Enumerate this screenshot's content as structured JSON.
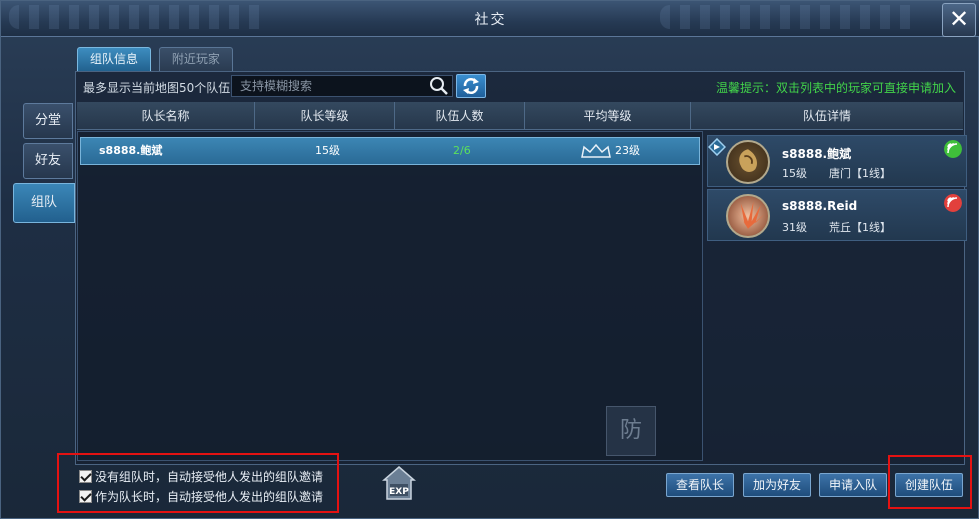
{
  "window": {
    "title": "社交",
    "close_label": "✕"
  },
  "side_tabs": [
    {
      "label": "分堂",
      "active": false
    },
    {
      "label": "好友",
      "active": false
    },
    {
      "label": "组队",
      "active": true
    }
  ],
  "top_tabs": [
    {
      "label": "组队信息",
      "active": true
    },
    {
      "label": "附近玩家",
      "active": false
    }
  ],
  "toolbar": {
    "info": "最多显示当前地图50个队伍",
    "search_placeholder": "支持模糊搜索",
    "tip": "温馨提示：双击列表中的玩家可直接申请加入"
  },
  "table": {
    "columns": [
      "队长名称",
      "队长等级",
      "队伍人数",
      "平均等级",
      "队伍详情"
    ],
    "rows": [
      {
        "leader": "s8888.鲍斌",
        "leader_level": "15级",
        "members": "2/6",
        "avg_level": "23级"
      }
    ]
  },
  "members": [
    {
      "name": "s8888.鲍斌",
      "level": "15级",
      "location": "唐门【1线】",
      "signal_color": "#3fbf3a",
      "leader": true
    },
    {
      "name": "s8888.Reid",
      "level": "31级",
      "location": "荒丘【1线】",
      "signal_color": "#e2403c",
      "leader": false
    }
  ],
  "options": [
    {
      "label": "没有组队时，自动接受他人发出的组队邀请",
      "checked": true
    },
    {
      "label": "作为队长时，自动接受他人发出的组队邀请",
      "checked": true
    }
  ],
  "buttons": {
    "view_leader": "查看队长",
    "add_friend": "加为好友",
    "apply_join": "申请入队",
    "create_team": "创建队伍"
  },
  "exp_label": "EXP",
  "background_seal": "防",
  "colors": {
    "accent": "#3c86b4",
    "tip_green": "#42d44a",
    "highlight_red": "#e41212"
  }
}
